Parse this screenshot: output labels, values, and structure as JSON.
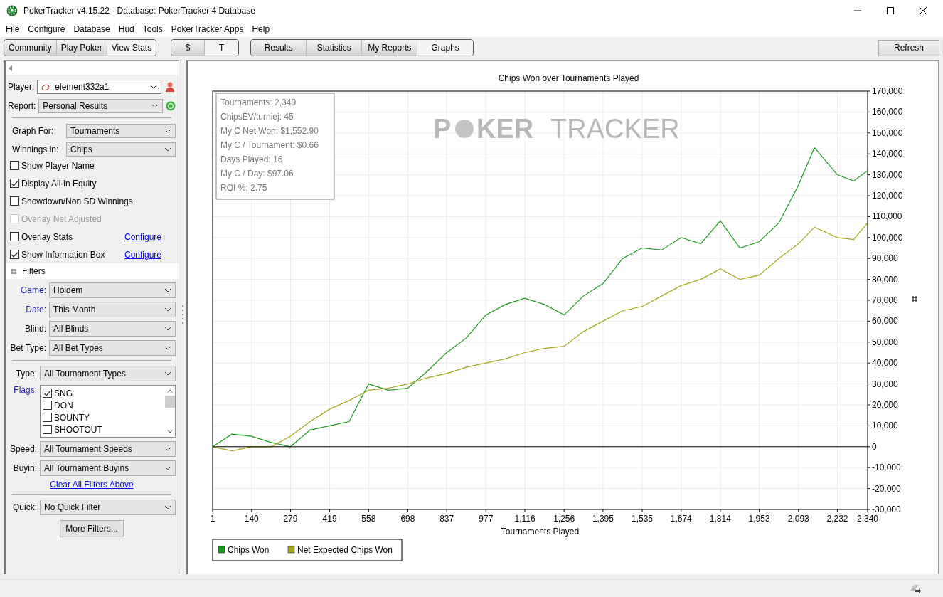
{
  "window": {
    "title": "PokerTracker v4.15.22 - Database: PokerTracker 4 Database"
  },
  "menu": [
    "File",
    "Configure",
    "Database",
    "Hud",
    "Tools",
    "PokerTracker Apps",
    "Help"
  ],
  "toolbar_groups": [
    [
      {
        "label": "Community",
        "selected": false
      },
      {
        "label": "Play Poker",
        "selected": false
      },
      {
        "label": "View Stats",
        "selected": true
      }
    ],
    [
      {
        "label": "$",
        "selected": false
      },
      {
        "label": "T",
        "selected": true
      }
    ],
    [
      {
        "label": "Results",
        "selected": false
      },
      {
        "label": "Statistics",
        "selected": false
      },
      {
        "label": "My Reports",
        "selected": false
      },
      {
        "label": "Graphs",
        "selected": true
      }
    ]
  ],
  "refresh_button": "Refresh",
  "sidebar": {
    "player": {
      "label": "Player:",
      "value": "element332a1"
    },
    "report": {
      "label": "Report:",
      "value": "Personal Results"
    },
    "graph_for": {
      "label": "Graph For:",
      "value": "Tournaments"
    },
    "winnings_in": {
      "label": "Winnings in:",
      "value": "Chips"
    },
    "options": [
      {
        "label": "Show Player Name",
        "checked": false,
        "disabled": false
      },
      {
        "label": "Display All-in Equity",
        "checked": true,
        "disabled": false
      },
      {
        "label": "Showdown/Non SD Winnings",
        "checked": false,
        "disabled": false
      },
      {
        "label": "Overlay Net Adjusted",
        "checked": false,
        "disabled": true
      },
      {
        "label": "Overlay Stats",
        "checked": false,
        "disabled": false,
        "link": "Configure"
      },
      {
        "label": "Show Information Box",
        "checked": true,
        "disabled": false,
        "link": "Configure"
      }
    ],
    "filters_header": "Filters",
    "filters": [
      {
        "label": "Game:",
        "value": "Holdem",
        "active": true
      },
      {
        "label": "Date:",
        "value": "This Month",
        "active": true
      },
      {
        "label": "Blind:",
        "value": "All Blinds",
        "active": false
      },
      {
        "label": "Bet Type:",
        "value": "All Bet Types",
        "active": false
      }
    ],
    "type": {
      "label": "Type:",
      "value": "All Tournament Types",
      "active": false
    },
    "flags": {
      "label": "Flags:",
      "active": true,
      "items": [
        {
          "label": "SNG",
          "checked": true
        },
        {
          "label": "DON",
          "checked": false
        },
        {
          "label": "BOUNTY",
          "checked": false
        },
        {
          "label": "SHOOTOUT",
          "checked": false
        }
      ]
    },
    "speed": {
      "label": "Speed:",
      "value": "All Tournament Speeds",
      "active": false
    },
    "buyin": {
      "label": "Buyin:",
      "value": "All Tournament Buyins",
      "active": false
    },
    "clear_link": "Clear All Filters Above",
    "quick": {
      "label": "Quick:",
      "value": "No Quick Filter",
      "active": false
    },
    "more_button": "More Filters..."
  },
  "chart": {
    "logo": [
      "P",
      "KER",
      "TRACKER"
    ],
    "info_box": [
      "Tournaments: 2,340",
      "ChipsEV/turniej: 45",
      "My C Net Won: $1,552.90",
      "My C / Tournament: $0.66",
      "Days Played: 16",
      "My C / Day: $97.06",
      "ROI %: 2.75"
    ],
    "chart_data": {
      "type": "line",
      "title": "Chips Won over Tournaments Played",
      "xlabel": "Tournaments Played",
      "x": [
        1,
        70,
        140,
        210,
        279,
        349,
        419,
        488,
        558,
        628,
        698,
        767,
        837,
        907,
        977,
        1046,
        1116,
        1186,
        1256,
        1325,
        1395,
        1465,
        1535,
        1604,
        1674,
        1744,
        1814,
        1884,
        1953,
        2023,
        2093,
        2150,
        2232,
        2290,
        2340
      ],
      "xlim": [
        1,
        2340
      ],
      "ylim": [
        -30000,
        170000
      ],
      "xticks": [
        1,
        140,
        279,
        419,
        558,
        698,
        837,
        977,
        {
          "value": 1116,
          "label": "1,116"
        },
        {
          "value": 1256,
          "label": "1,256"
        },
        {
          "value": 1395,
          "label": "1,395"
        },
        {
          "value": 1535,
          "label": "1,535"
        },
        {
          "value": 1674,
          "label": "1,674"
        },
        {
          "value": 1814,
          "label": "1,814"
        },
        {
          "value": 1953,
          "label": "1,953"
        },
        {
          "value": 2093,
          "label": "2,093"
        },
        {
          "value": 2232,
          "label": "2,232"
        },
        {
          "value": 2340,
          "label": "2,340"
        }
      ],
      "yticks": [
        {
          "value": -30000,
          "label": "-30,000"
        },
        {
          "value": -20000,
          "label": "-20,000"
        },
        {
          "value": -10000,
          "label": "-10,000"
        },
        0,
        {
          "value": 10000,
          "label": "10,000"
        },
        {
          "value": 20000,
          "label": "20,000"
        },
        {
          "value": 30000,
          "label": "30,000"
        },
        {
          "value": 40000,
          "label": "40,000"
        },
        {
          "value": 50000,
          "label": "50,000"
        },
        {
          "value": 60000,
          "label": "60,000"
        },
        {
          "value": 70000,
          "label": "70,000"
        },
        {
          "value": 80000,
          "label": "80,000"
        },
        {
          "value": 90000,
          "label": "90,000"
        },
        {
          "value": 100000,
          "label": "100,000"
        },
        {
          "value": 110000,
          "label": "110,000"
        },
        {
          "value": 120000,
          "label": "120,000"
        },
        {
          "value": 130000,
          "label": "130,000"
        },
        {
          "value": 140000,
          "label": "140,000"
        },
        {
          "value": 150000,
          "label": "150,000"
        },
        {
          "value": 160000,
          "label": "160,000"
        },
        {
          "value": 170000,
          "label": "170,000"
        }
      ],
      "grid": true,
      "legend": true,
      "series": [
        {
          "name": "Chips Won",
          "color": "#1a9a1a",
          "values": [
            0,
            6000,
            5000,
            2000,
            0,
            8000,
            10000,
            12000,
            30000,
            27000,
            28000,
            36000,
            45000,
            52000,
            63000,
            68000,
            71000,
            68000,
            63000,
            72000,
            78000,
            90000,
            95000,
            94000,
            100000,
            97000,
            108000,
            95000,
            98000,
            107000,
            125000,
            143000,
            130000,
            127000,
            132000
          ]
        },
        {
          "name": "Net Expected Chips Won",
          "color": "#a6a61a",
          "values": [
            0,
            -2000,
            0,
            0,
            5000,
            12000,
            18000,
            22000,
            27000,
            28000,
            30000,
            33000,
            35000,
            38000,
            40000,
            42000,
            45000,
            47000,
            48000,
            55000,
            60000,
            65000,
            67000,
            72000,
            77000,
            80000,
            85000,
            80000,
            82000,
            90000,
            97000,
            105000,
            100000,
            99000,
            107000
          ]
        }
      ]
    }
  }
}
